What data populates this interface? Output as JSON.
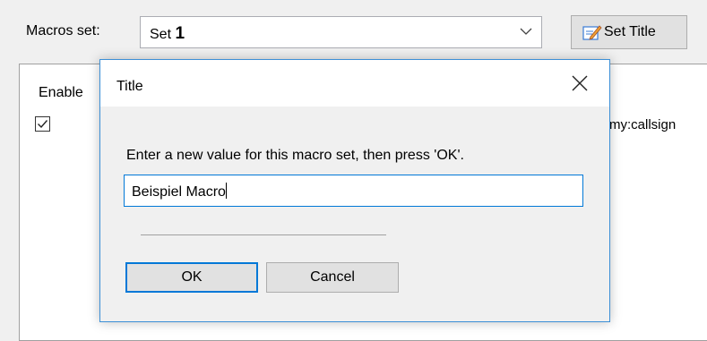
{
  "toolbar": {
    "macros_label": "Macros set:",
    "combo_prefix": "Set",
    "combo_number": "1",
    "set_title_label": "Set Title"
  },
  "background": {
    "enable_header": "Enable",
    "callsign_text": "my:callsign"
  },
  "dialog": {
    "title": "Title",
    "prompt": "Enter a new value for this macro set, then press 'OK'.",
    "input_value": "Beispiel Macro",
    "ok_label": "OK",
    "cancel_label": "Cancel"
  },
  "colors": {
    "accent": "#0078d7",
    "button_face": "#e1e1e1",
    "window_bg": "#f0f0f0"
  }
}
